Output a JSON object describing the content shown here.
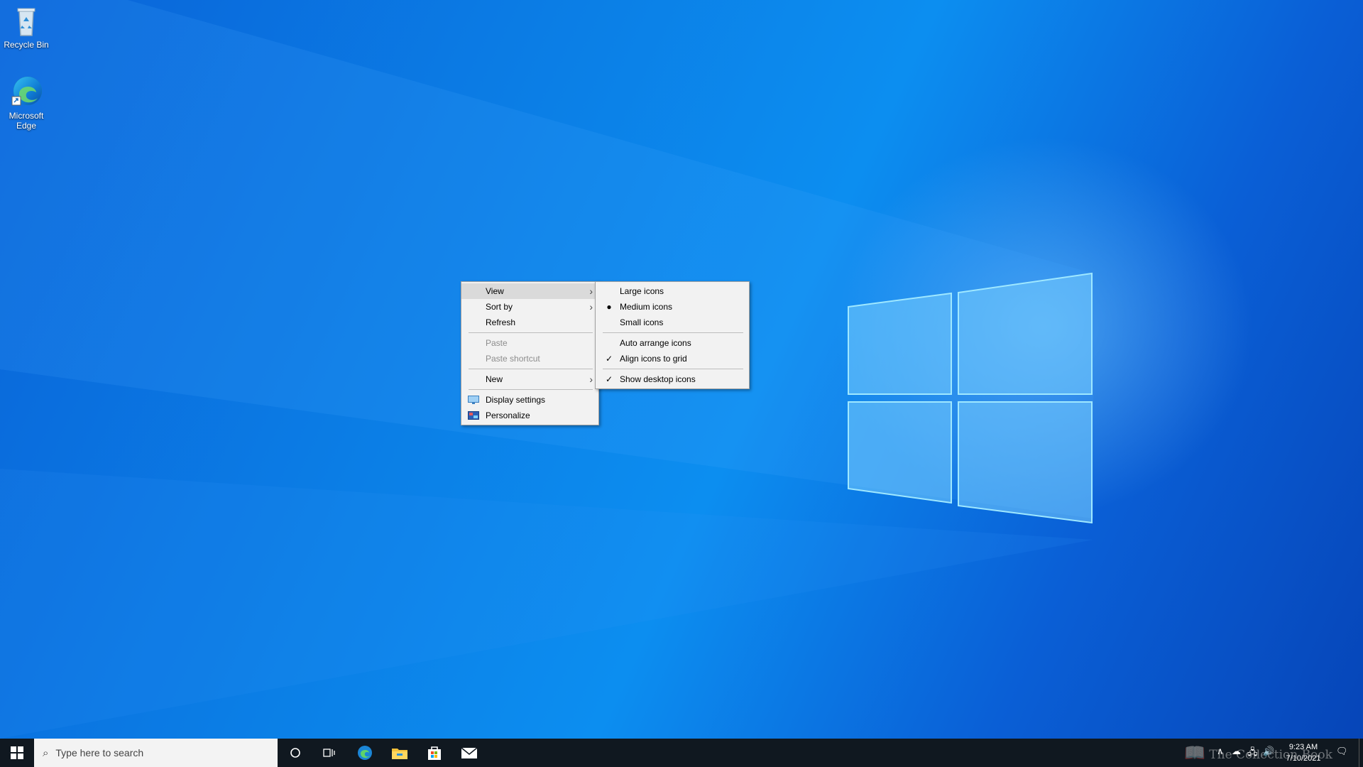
{
  "desktop": {
    "icons": [
      {
        "label": "Recycle Bin",
        "icon": "recycle-bin-icon"
      },
      {
        "label": "Microsoft Edge",
        "icon": "edge-icon"
      }
    ]
  },
  "context_menu": {
    "items": [
      {
        "label": "View",
        "submenu": true,
        "highlighted": true
      },
      {
        "label": "Sort by",
        "submenu": true
      },
      {
        "label": "Refresh"
      },
      {
        "label": "Paste",
        "disabled": true
      },
      {
        "label": "Paste shortcut",
        "disabled": true
      },
      {
        "label": "New",
        "submenu": true
      },
      {
        "label": "Display settings",
        "icon": "display-settings-icon"
      },
      {
        "label": "Personalize",
        "icon": "personalize-icon"
      }
    ]
  },
  "view_submenu": {
    "items": [
      {
        "label": "Large icons"
      },
      {
        "label": "Medium icons",
        "radio_selected": true
      },
      {
        "label": "Small icons"
      },
      {
        "label": "Auto arrange icons"
      },
      {
        "label": "Align icons to grid",
        "checked": true
      },
      {
        "label": "Show desktop icons",
        "checked": true
      }
    ]
  },
  "taskbar": {
    "search_placeholder": "Type here to search",
    "pinned": [
      "edge-icon",
      "file-explorer-icon",
      "store-icon",
      "mail-icon"
    ],
    "clock": {
      "time": "9:23 AM",
      "date": "7/10/2021"
    }
  },
  "watermark": "The Collection Book",
  "colors": {
    "accent": "#0a78e6",
    "taskbar": "#101820",
    "menu_bg": "#f2f2f2"
  }
}
